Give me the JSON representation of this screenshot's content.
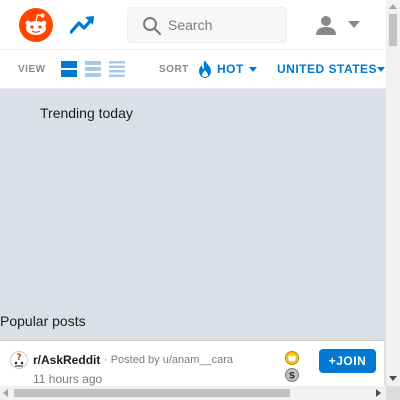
{
  "header": {
    "logo_icon": "reddit-logo-icon",
    "trending_icon": "trending-up-icon",
    "search": {
      "placeholder": "Search",
      "value": ""
    },
    "user_icon": "user-icon",
    "caret_icon": "chevron-down-icon"
  },
  "sortbar": {
    "view_label": "VIEW",
    "view_options": [
      "card",
      "classic",
      "compact"
    ],
    "selected_view": "card",
    "sort_label": "SORT",
    "sort_value": "HOT",
    "location_value": "UNITED STATES"
  },
  "trending": {
    "title": "Trending today"
  },
  "popular": {
    "title": "Popular posts",
    "post": {
      "subreddit": "r/AskReddit",
      "posted_by": "· Posted by u/anam__cara",
      "time": "11 hours ago",
      "join_label": "+JOIN"
    }
  },
  "colors": {
    "accent": "#0079d3",
    "brand": "#ff4500",
    "background": "#dae0e6"
  }
}
